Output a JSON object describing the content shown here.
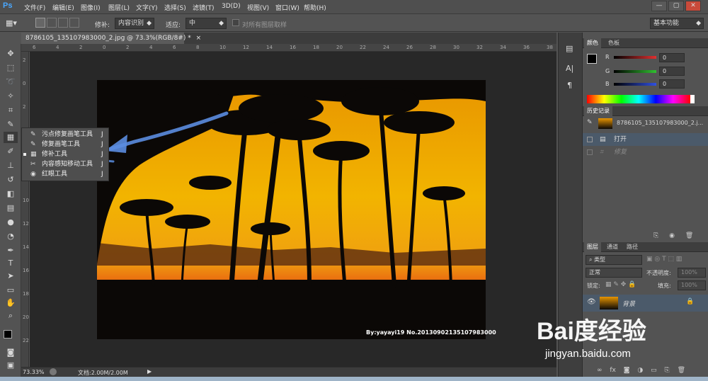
{
  "app": {
    "logo": "Ps"
  },
  "menu": [
    "文件(F)",
    "编辑(E)",
    "图像(I)",
    "图层(L)",
    "文字(Y)",
    "选择(S)",
    "滤镜(T)",
    "3D(D)",
    "视图(V)",
    "窗口(W)",
    "帮助(H)"
  ],
  "window_controls": {
    "minimize": "—",
    "restore": "▢",
    "close": "✕"
  },
  "options_bar": {
    "repair_label": "修补:",
    "repair_value": "内容识别",
    "adapt_label": "适应:",
    "adapt_value": "中",
    "sample_all_label": "对所有图层取样",
    "workspace": "基本功能"
  },
  "document": {
    "tab_title": "8786105_135107983000_2.jpg @ 73.3%(RGB/8#) *",
    "close": "×",
    "ruler_h": [
      "6",
      "4",
      "2",
      "0",
      "2",
      "4",
      "6",
      "8",
      "10",
      "12",
      "14",
      "16",
      "18",
      "20",
      "22",
      "24",
      "26",
      "28",
      "30",
      "32",
      "34",
      "36",
      "38"
    ],
    "ruler_v": [
      "2",
      "0",
      "2",
      "4",
      "6",
      "8",
      "10",
      "12",
      "14",
      "16",
      "18",
      "20",
      "22"
    ],
    "watermark": "By:yayayi19 No.20130902135107983000"
  },
  "flyout": {
    "items": [
      {
        "icon": "spot-healing-brush-icon",
        "label": "污点修复画笔工具",
        "shortcut": "J"
      },
      {
        "icon": "healing-brush-icon",
        "label": "修复画笔工具",
        "shortcut": "J"
      },
      {
        "icon": "patch-tool-icon",
        "label": "修补工具",
        "shortcut": "J",
        "selected": true
      },
      {
        "icon": "content-aware-move-icon",
        "label": "内容感知移动工具",
        "shortcut": "J"
      },
      {
        "icon": "red-eye-icon",
        "label": "红眼工具",
        "shortcut": "J"
      }
    ]
  },
  "status": {
    "zoom": "73.33%",
    "doc": "文档:2.00M/2.00M"
  },
  "color_panel": {
    "tabs": [
      "颜色",
      "色板"
    ],
    "r_label": "R",
    "r_value": "0",
    "g_label": "G",
    "g_value": "0",
    "b_label": "B",
    "b_value": "0",
    "colors": {
      "r": "#e03030",
      "g": "#30c030",
      "b": "#3050e0"
    }
  },
  "history_panel": {
    "tab": "历史记录",
    "snapshot": "8786105_135107983000_2.j...",
    "items": [
      "打开",
      "修复"
    ]
  },
  "layers_panel": {
    "tabs": [
      "图层",
      "通道",
      "路径"
    ],
    "kind_label": "类型",
    "blend_mode": "正常",
    "opacity_label": "不透明度:",
    "opacity_value": "100%",
    "lock_label": "锁定:",
    "fill_label": "填充:",
    "fill_value": "100%",
    "layer_name": "背景"
  },
  "brand": {
    "name": "Bai度经验",
    "url": "jingyan.baidu.com"
  },
  "theme": {
    "accent": "#4a90e2",
    "photo_sky_top": "#f0a000",
    "photo_sky_bottom": "#e85a10"
  }
}
